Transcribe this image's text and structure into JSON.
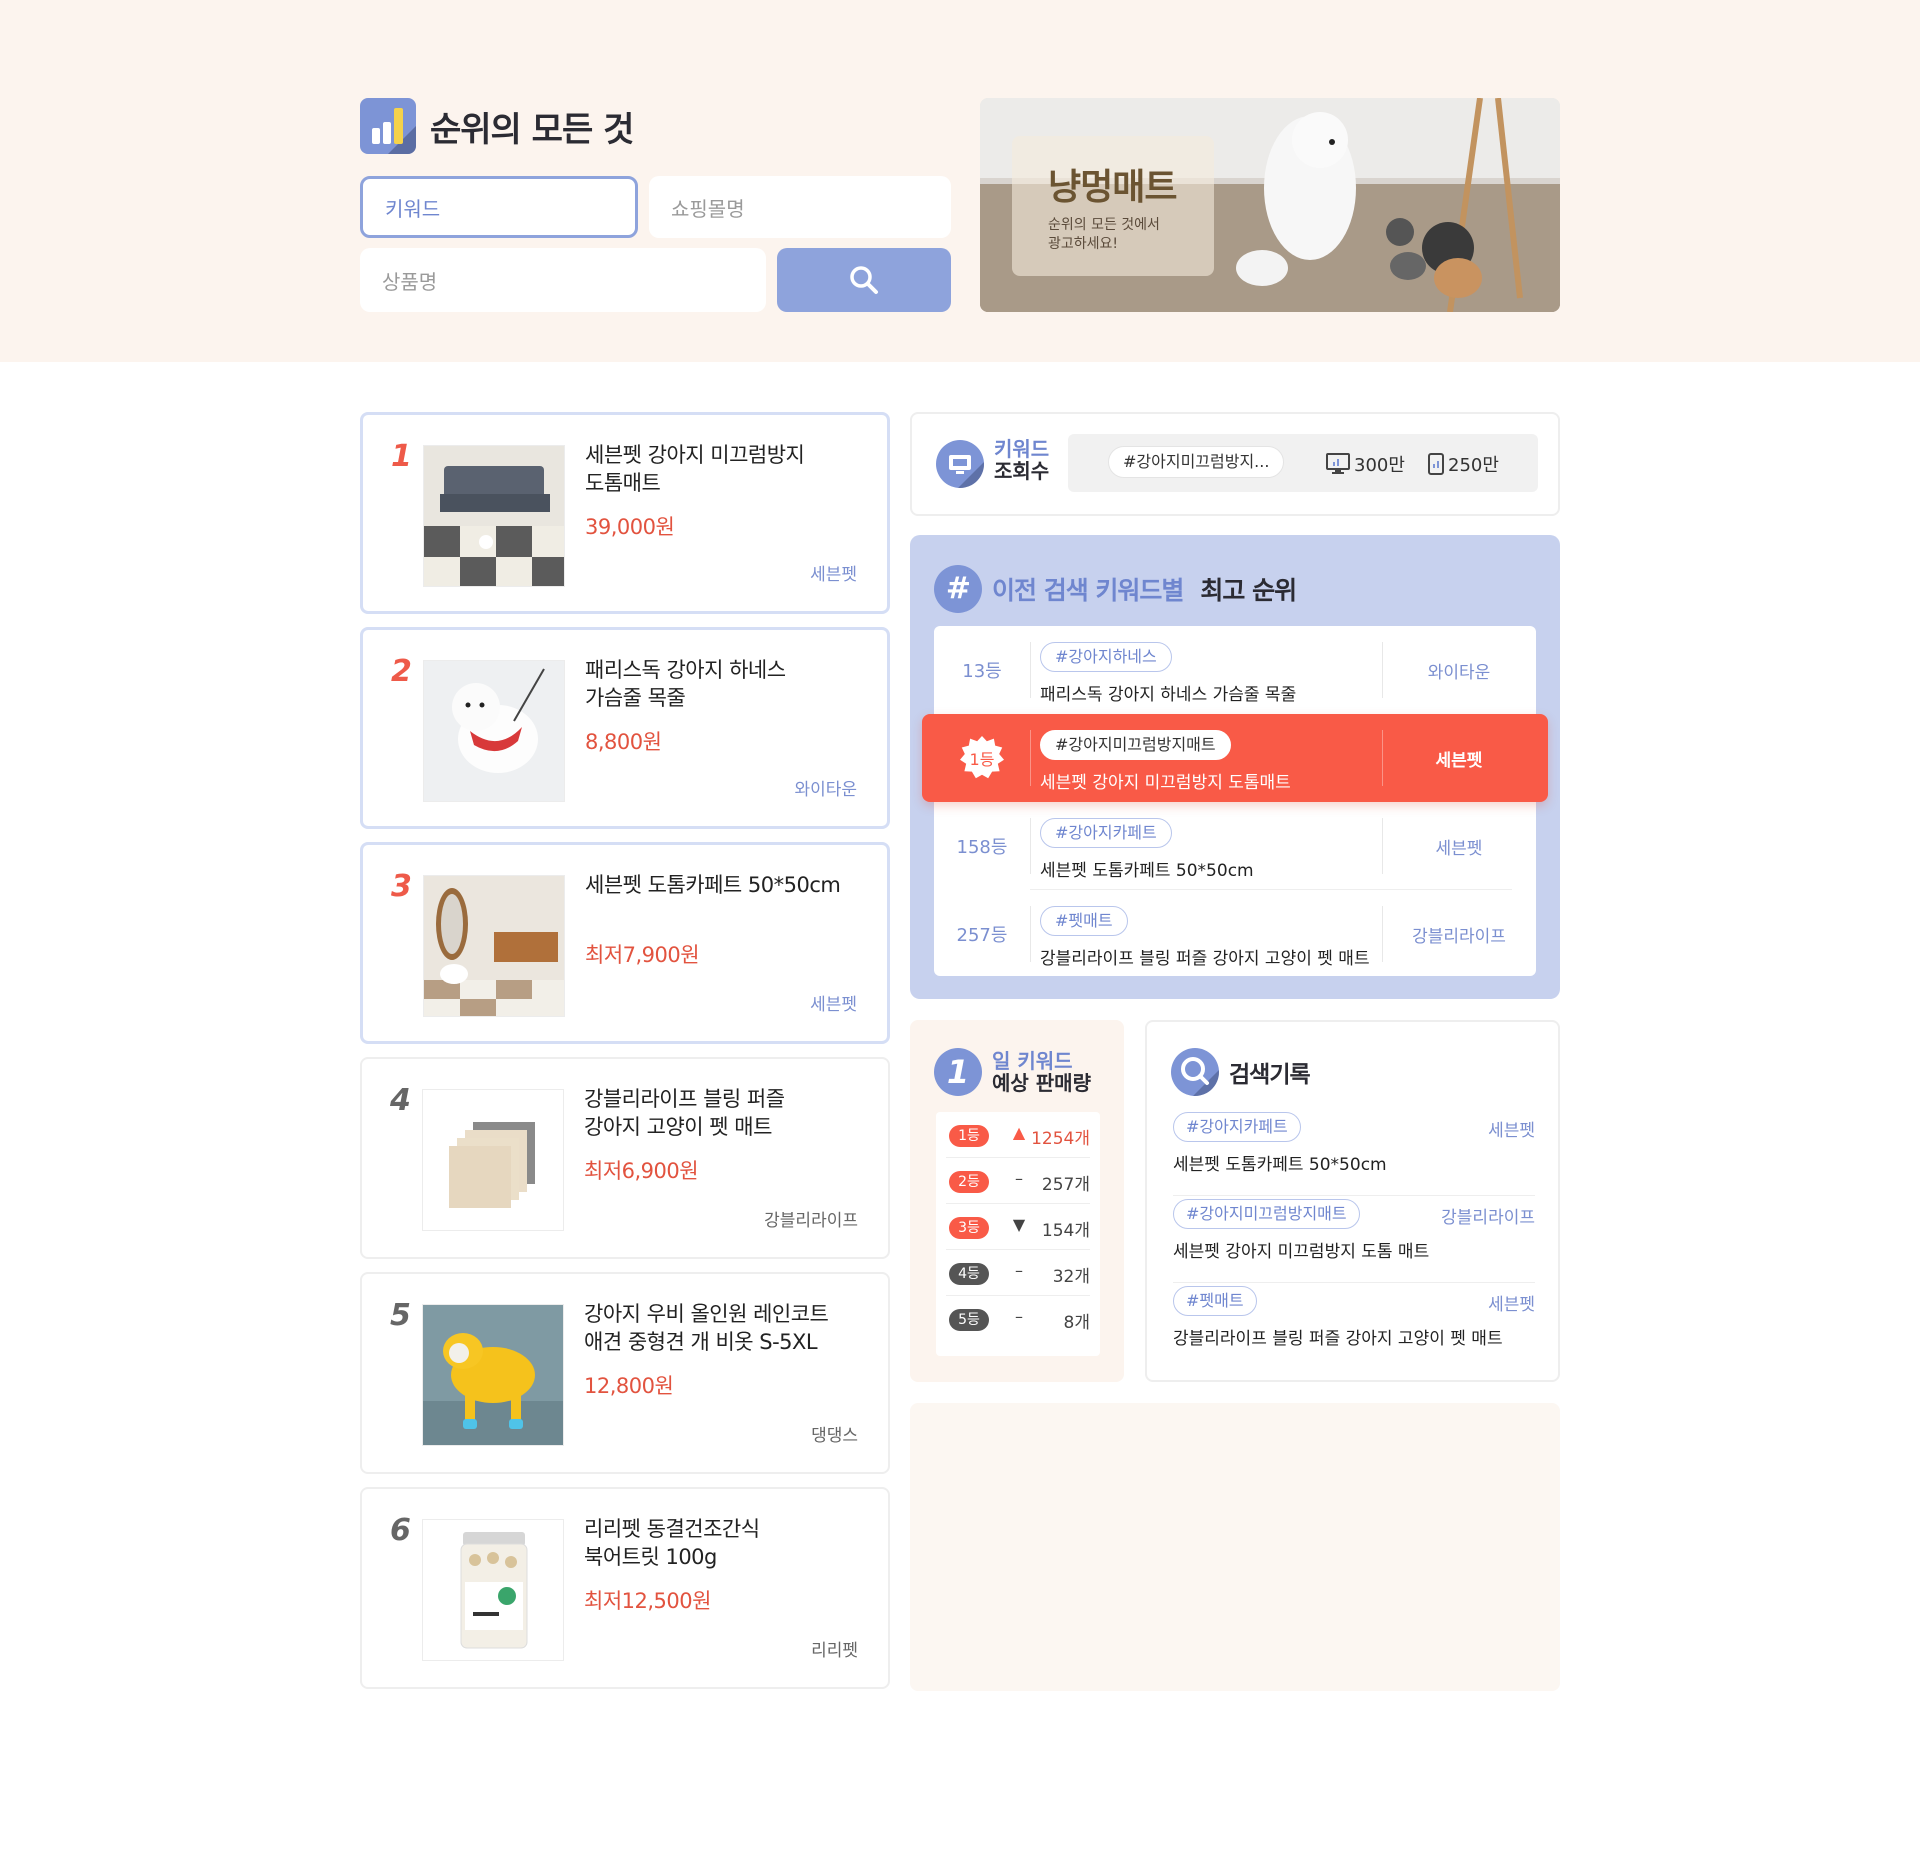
{
  "header": {
    "title": "순위의 모든 것",
    "keyword_placeholder": "키워드",
    "mall_placeholder": "쇼핑몰명",
    "product_placeholder": "상품명"
  },
  "ad": {
    "title": "냥멍매트",
    "line1": "순위의 모든 것에서",
    "line2": "광고하세요!"
  },
  "products": [
    {
      "rank": "1",
      "name_line1": "세븐펫 강아지 미끄럼방지",
      "name_line2": "도톰매트",
      "price": "39,000원",
      "shop": "세븐펫"
    },
    {
      "rank": "2",
      "name_line1": "패리스독 강아지 하네스",
      "name_line2": "가슴줄 목줄",
      "price": "8,800원",
      "shop": "와이타운"
    },
    {
      "rank": "3",
      "name_line1": "세븐펫 도톰카페트 50*50cm",
      "name_line2": "",
      "price": "최저7,900원",
      "shop": "세븐펫"
    },
    {
      "rank": "4",
      "name_line1": "강블리라이프 블링 퍼즐",
      "name_line2": "강아지 고양이 펫 매트",
      "price": "최저6,900원",
      "shop": "강블리라이프"
    },
    {
      "rank": "5",
      "name_line1": "강아지 우비 올인원 레인코트",
      "name_line2": "애견 중형견 개 비옷 S-5XL",
      "price": "12,800원",
      "shop": "댕댕스"
    },
    {
      "rank": "6",
      "name_line1": "리리펫 동결건조간식",
      "name_line2": "북어트릿 100g",
      "price": "최저12,500원",
      "shop": "리리펫"
    }
  ],
  "keyword_views": {
    "label_line1": "키워드",
    "label_line2": "조회수",
    "tag": "#강아지미끄럼방지...",
    "pc": "300만",
    "mobile": "250만"
  },
  "best_rank": {
    "title_blue": "이전 검색 키워드별",
    "title_dark": "최고 순위",
    "rows": [
      {
        "rank": "13등",
        "tag": "#강아지하네스",
        "name": "패리스독 강아지 하네스 가슴줄 목줄",
        "shop": "와이타운"
      },
      {
        "rank": "1등",
        "tag": "#강아지미끄럼방지매트",
        "name": "세븐펫 강아지 미끄럼방지 도톰매트",
        "shop": "세븐펫"
      },
      {
        "rank": "158등",
        "tag": "#강아지카페트",
        "name": "세븐펫 도톰카페트 50*50cm",
        "shop": "세븐펫"
      },
      {
        "rank": "257등",
        "tag": "#펫매트",
        "name": "강블리라이프 블링 퍼즐 강아지 고양이 펫 매트",
        "shop": "강블리라이프"
      }
    ]
  },
  "daily": {
    "title_line1": "일 키워드",
    "title_line2": "예상 판매량",
    "rows": [
      {
        "rank": "1등",
        "trend": "▲",
        "count": "1254개"
      },
      {
        "rank": "2등",
        "trend": "–",
        "count": "257개"
      },
      {
        "rank": "3등",
        "trend": "▼",
        "count": "154개"
      },
      {
        "rank": "4등",
        "trend": "–",
        "count": "32개"
      },
      {
        "rank": "5등",
        "trend": "–",
        "count": "8개"
      }
    ]
  },
  "history": {
    "title": "검색기록",
    "items": [
      {
        "tag": "#강아지카페트",
        "shop": "세븐펫",
        "name": "세븐펫 도톰카페트 50*50cm"
      },
      {
        "tag": "#강아지미끄럼방지매트",
        "shop": "강블리라이프",
        "name": "세븐펫 강아지 미끄럼방지 도톰 매트"
      },
      {
        "tag": "#펫매트",
        "shop": "세븐펫",
        "name": "강블리라이프 블링 퍼즐 강아지 고양이 펫 매트"
      }
    ]
  },
  "colors": {
    "accent_blue": "#8ea3dc",
    "highlight_red": "#f95a47",
    "price_red": "#e2533f",
    "top_band": "#fcf4ee"
  },
  "icons": {
    "brand": "bar-chart-icon",
    "search": "search-icon",
    "monitor": "monitor-icon",
    "mobile": "mobile-icon",
    "hash": "hash-icon",
    "daily": "number-one-icon",
    "history": "magnifier-icon"
  }
}
